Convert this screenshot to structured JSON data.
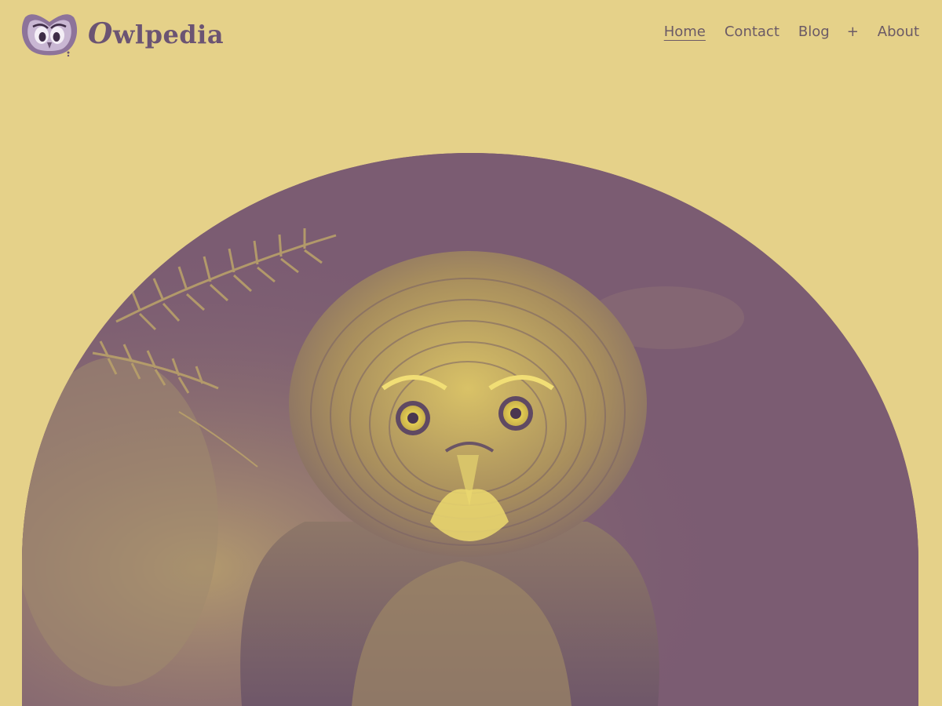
{
  "brand": {
    "name_cap": "O",
    "name_rest": "wlpedia",
    "logo_icon": "owl-face-icon"
  },
  "nav": {
    "items": [
      {
        "label": "Home",
        "current": true
      },
      {
        "label": "Contact",
        "current": false
      },
      {
        "label": "Blog",
        "current": false
      },
      {
        "label": "+",
        "current": false
      },
      {
        "label": "About",
        "current": false
      }
    ]
  },
  "hero": {
    "image_icon": "great-grey-owl-photo"
  },
  "colors": {
    "background": "#e5d189",
    "brand": "#6b5473",
    "duotone_dark": "#7b5c72",
    "duotone_light": "#e8d46e"
  }
}
